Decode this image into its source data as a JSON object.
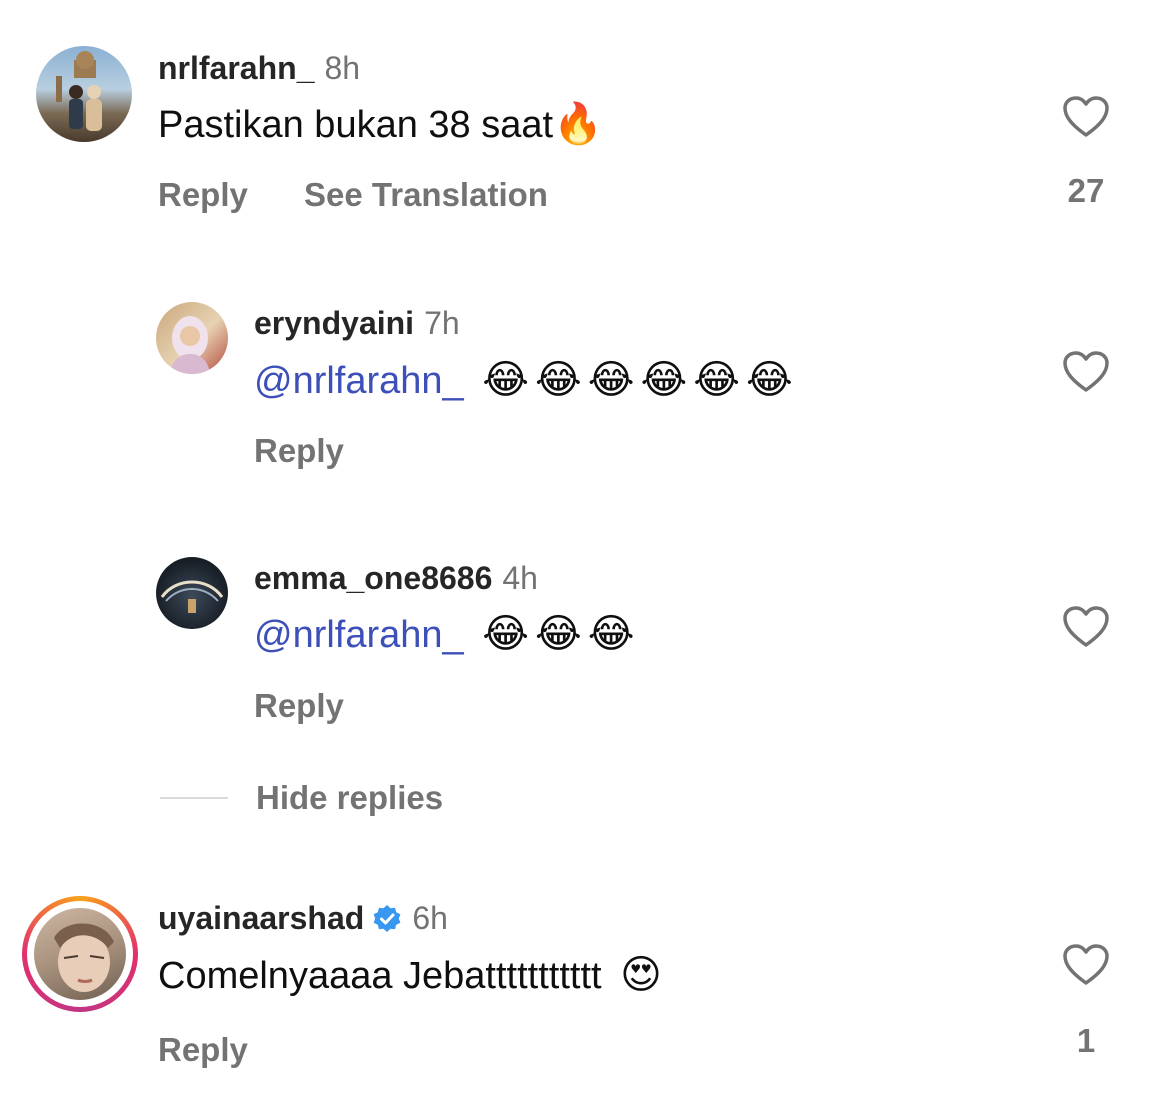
{
  "comments": [
    {
      "username": "nrlfarahn_",
      "time": "8h",
      "text": "Pastikan bukan 38 saat",
      "emoji": "🔥",
      "reply_label": "Reply",
      "translate_label": "See Translation",
      "likes": "27"
    },
    {
      "username": "eryndyaini",
      "time": "7h",
      "mention": "@nrlfarahn_",
      "emojis": "😂😂😂😂😂😂",
      "reply_label": "Reply"
    },
    {
      "username": "emma_one8686",
      "time": "4h",
      "mention": "@nrlfarahn_",
      "emojis": "😂😂😂",
      "reply_label": "Reply"
    },
    {
      "username": "uyainaarshad",
      "verified": true,
      "time": "6h",
      "text": "Comelnyaaaa Jebattttttttttt",
      "emoji": "😍",
      "reply_label": "Reply",
      "likes": "1"
    }
  ],
  "hide_replies_label": "Hide replies",
  "icons": {
    "like": "heart-outline-icon",
    "verified": "verified-badge-icon"
  },
  "colors": {
    "mention": "#3d4fb8",
    "verified": "#3897f0",
    "secondary_text": "#737373"
  }
}
